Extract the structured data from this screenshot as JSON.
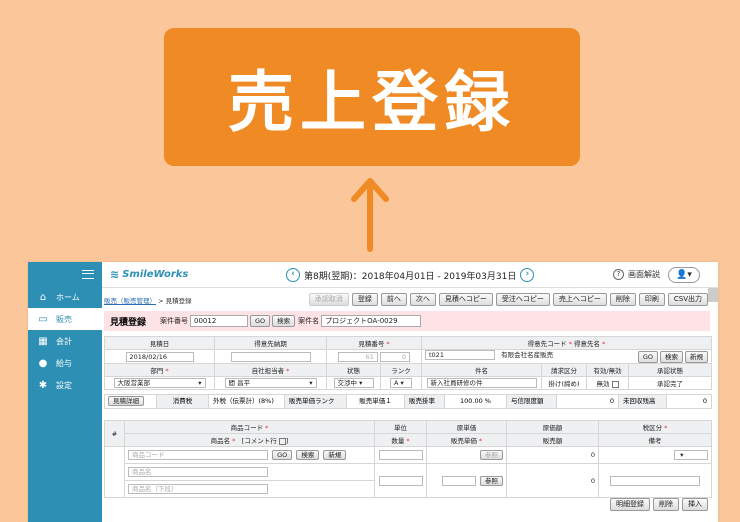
{
  "callout": {
    "title": "売上登録"
  },
  "sidebar": {
    "items": [
      {
        "label": "ホーム",
        "icon": "home-icon",
        "glyph": "⌂"
      },
      {
        "label": "販売",
        "icon": "cart-icon",
        "glyph": "🛒"
      },
      {
        "label": "会計",
        "icon": "calculator-icon",
        "glyph": "▦"
      },
      {
        "label": "給与",
        "icon": "money-bag-icon",
        "glyph": "●"
      },
      {
        "label": "設定",
        "icon": "gear-icon",
        "glyph": "✱"
      }
    ]
  },
  "header": {
    "logo": "SmileWorks",
    "period": "第8期(翌期)：2018年04月01日 - 2019年03月31日",
    "help": "画面解説",
    "prev": "‹",
    "next": "›"
  },
  "breadcrumb": {
    "link": "販売（販売管理）",
    "current": "> 見積登録"
  },
  "toolbar": [
    "承認取消",
    "登録",
    "前へ",
    "次へ",
    "見積へコピー",
    "受注へコピー",
    "売上へコピー",
    "削除",
    "印刷",
    "CSV出力"
  ],
  "title_bar": {
    "title": "見積登録",
    "case_no_label": "案件番号",
    "case_no": "00012",
    "go": "GO",
    "search": "検索",
    "case_name_label": "案件名",
    "case_name": "プロジェクトOA-0029"
  },
  "header_table": {
    "row1_headers": [
      "見積日",
      "得意先納期",
      "見積番号",
      "得意先コード",
      "得意先名"
    ],
    "estimate_date": "2018/02/16",
    "estimate_no": "61",
    "estimate_no_sub": "0",
    "customer_code": "t021",
    "customer_name": "有限会社名産販売",
    "go": "GO",
    "search": "検索",
    "new": "新規",
    "row2_headers": [
      "部門",
      "自社担当者",
      "状態",
      "ランク",
      "件名",
      "請求区分",
      "有効/無効",
      "承認状態"
    ],
    "department": "大阪営業部",
    "staff": "間 昌平",
    "status": "交渉中",
    "rank": "A",
    "subject": "新入社員研修の件",
    "billing": "掛け(締め)",
    "valid": "無効",
    "approval": "承認完了"
  },
  "summary": {
    "detail_btn": "見積詳細",
    "tax_label": "消費税",
    "tax_value": "外税（伝票計）(8%)",
    "rank_label": "販売単価ランク",
    "rank_value": "販売単価１",
    "rate_label": "販売掛率",
    "rate_value": "100.00 %",
    "credit_label": "与信限度額",
    "credit_value": "0",
    "uncollected_label": "未回収残高",
    "uncollected_value": "0"
  },
  "detail_table": {
    "hash": "#",
    "product_code": "商品コード",
    "product_name": "商品名",
    "comment_row": "[コメント行",
    "unit": "単位",
    "qty": "数量",
    "cost_price": "原単価",
    "sale_price": "販売単価",
    "cost_amount": "原価額",
    "sale_amount": "販売額",
    "tax_class": "税区分",
    "remarks": "備考",
    "ph_code": "商品コード",
    "ph_name": "商品名",
    "ph_name_lower": "商品名（下段）",
    "go": "GO",
    "search": "検索",
    "new": "新規",
    "ref": "参照",
    "zero": "0"
  },
  "bottom": [
    "明細登録",
    "削除",
    "挿入"
  ]
}
